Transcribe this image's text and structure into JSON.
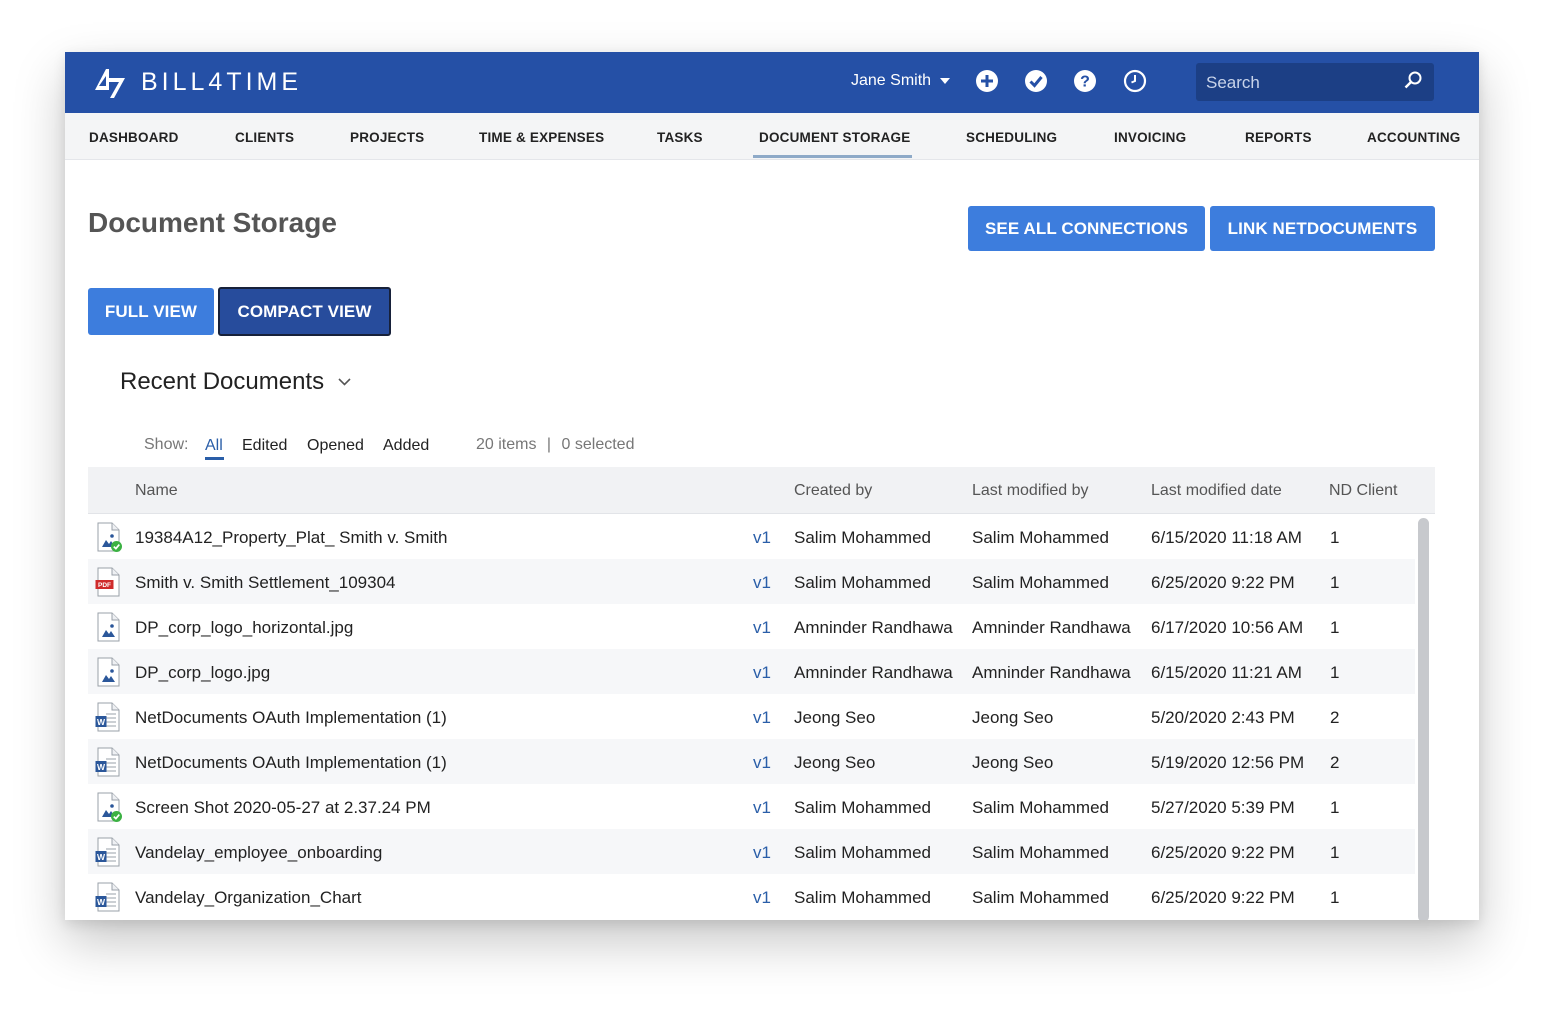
{
  "app": {
    "name": "BILL4TIME",
    "user_name": "Jane Smith",
    "search_placeholder": "Search",
    "colors": {
      "topbar": "#2550a6",
      "accent": "#3d7ddd",
      "active_view": "#274c9c",
      "link": "#2a5ea8"
    }
  },
  "toolbar_icons": [
    "plus-circle-icon",
    "check-circle-icon",
    "help-icon",
    "clock-icon",
    "search-icon"
  ],
  "nav": {
    "items": [
      "DASHBOARD",
      "CLIENTS",
      "PROJECTS",
      "TIME & EXPENSES",
      "TASKS",
      "DOCUMENT STORAGE",
      "SCHEDULING",
      "INVOICING",
      "REPORTS",
      "ACCOUNTING"
    ],
    "active": "DOCUMENT STORAGE"
  },
  "page": {
    "title": "Document Storage",
    "see_all_connections": "SEE ALL CONNECTIONS",
    "link_netdocuments": "LINK NETDOCUMENTS",
    "full_view": "FULL VIEW",
    "compact_view": "COMPACT VIEW",
    "section_title": "Recent Documents"
  },
  "filters": {
    "label": "Show:",
    "options": [
      "All",
      "Edited",
      "Opened",
      "Added"
    ],
    "active": "All",
    "items_count": "20 items",
    "separator": "|",
    "selected_count": "0 selected"
  },
  "table": {
    "columns": {
      "name": "Name",
      "created_by": "Created by",
      "last_modified_by": "Last modified by",
      "last_modified_date": "Last modified date",
      "nd_client": "ND Client"
    },
    "rows": [
      {
        "icon": "image-check-icon",
        "name": "19384A12_Property_Plat_ Smith v. Smith",
        "version": "v1",
        "created_by": "Salim Mohammed",
        "modified_by": "Salim Mohammed",
        "modified_date": "6/15/2020 11:18 AM",
        "client": "1"
      },
      {
        "icon": "pdf-file-icon",
        "name": "Smith v. Smith Settlement_109304",
        "version": "v1",
        "created_by": "Salim Mohammed",
        "modified_by": "Salim Mohammed",
        "modified_date": "6/25/2020 9:22 PM",
        "client": "1"
      },
      {
        "icon": "image-file-icon",
        "name": "DP_corp_logo_horizontal.jpg",
        "version": "v1",
        "created_by": "Amninder Randhawa",
        "modified_by": "Amninder Randhawa",
        "modified_date": "6/17/2020 10:56 AM",
        "client": "1"
      },
      {
        "icon": "image-file-icon",
        "name": "DP_corp_logo.jpg",
        "version": "v1",
        "created_by": "Amninder Randhawa",
        "modified_by": "Amninder Randhawa",
        "modified_date": "6/15/2020 11:21 AM",
        "client": "1"
      },
      {
        "icon": "word-file-icon",
        "name": "NetDocuments OAuth Implementation (1)",
        "version": "v1",
        "created_by": "Jeong Seo",
        "modified_by": "Jeong Seo",
        "modified_date": "5/20/2020 2:43 PM",
        "client": "2"
      },
      {
        "icon": "word-file-icon",
        "name": "NetDocuments OAuth Implementation (1)",
        "version": "v1",
        "created_by": "Jeong Seo",
        "modified_by": "Jeong Seo",
        "modified_date": "5/19/2020 12:56 PM",
        "client": "2"
      },
      {
        "icon": "image-check-icon",
        "name": "Screen Shot 2020-05-27 at 2.37.24 PM",
        "version": "v1",
        "created_by": "Salim Mohammed",
        "modified_by": "Salim Mohammed",
        "modified_date": "5/27/2020 5:39 PM",
        "client": "1"
      },
      {
        "icon": "word-file-icon",
        "name": "Vandelay_employee_onboarding",
        "version": "v1",
        "created_by": "Salim Mohammed",
        "modified_by": "Salim Mohammed",
        "modified_date": "6/25/2020 9:22 PM",
        "client": "1"
      },
      {
        "icon": "word-file-icon",
        "name": "Vandelay_Organization_Chart",
        "version": "v1",
        "created_by": "Salim Mohammed",
        "modified_by": "Salim Mohammed",
        "modified_date": "6/25/2020 9:22 PM",
        "client": "1"
      }
    ]
  }
}
